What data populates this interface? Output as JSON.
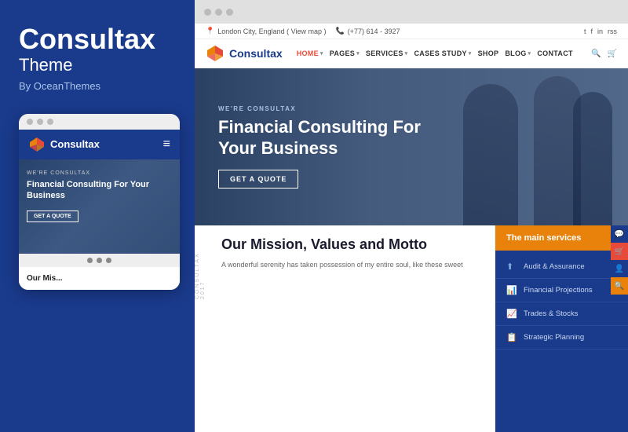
{
  "left": {
    "title": "Consultax",
    "subtitle": "Theme",
    "by": "By OceanThemes",
    "mobile": {
      "dots": [
        "dot1",
        "dot2",
        "dot3"
      ],
      "logo": "Consultax",
      "hero_tag": "WE'RE CONSULTAX",
      "hero_title": "Financial Consulting For Your Business",
      "hero_btn": "GET A QUOTE",
      "bottom_dots": [
        "d1",
        "d2",
        "d3"
      ],
      "mission_title": "Our Mis..."
    }
  },
  "browser": {
    "dots": [
      "dot1",
      "dot2",
      "dot3"
    ],
    "topbar": {
      "location": "London City, England ( View map )",
      "phone": "(+77) 614 - 3927",
      "social": [
        "t",
        "f",
        "in",
        "rss"
      ]
    },
    "navbar": {
      "logo": "Consultax",
      "items": [
        {
          "label": "HOME",
          "active": true,
          "has_arrow": true
        },
        {
          "label": "PAGES",
          "active": false,
          "has_arrow": true
        },
        {
          "label": "SERVICES",
          "active": false,
          "has_arrow": true
        },
        {
          "label": "CASES STUDY",
          "active": false,
          "has_arrow": true
        },
        {
          "label": "SHOP",
          "active": false,
          "has_arrow": false
        },
        {
          "label": "BLOG",
          "active": false,
          "has_arrow": true
        },
        {
          "label": "CONTACT",
          "active": false,
          "has_arrow": false
        }
      ]
    },
    "hero": {
      "tag": "WE'RE CONSULTAX",
      "title": "Financial Consulting For Your Business",
      "btn": "GET A QUOTE"
    },
    "sidebar": {
      "header": "The main services",
      "services": [
        {
          "icon": "⬆",
          "name": "Audit & Assurance"
        },
        {
          "icon": "📊",
          "name": "Financial Projections"
        },
        {
          "icon": "📈",
          "name": "Trades & Stocks"
        },
        {
          "icon": "📋",
          "name": "Strategic Planning"
        }
      ]
    },
    "main": {
      "label": "CONSULTAX 2017",
      "mission_title": "Our Mission, Values and Motto",
      "mission_text": "A wonderful serenity has taken possession of my entire soul, like these sweet"
    },
    "floating": [
      {
        "icon": "💬",
        "type": "blue"
      },
      {
        "icon": "🛒",
        "type": "red"
      },
      {
        "icon": "👤",
        "type": "blue2"
      },
      {
        "icon": "🔍",
        "type": "orange"
      }
    ]
  }
}
